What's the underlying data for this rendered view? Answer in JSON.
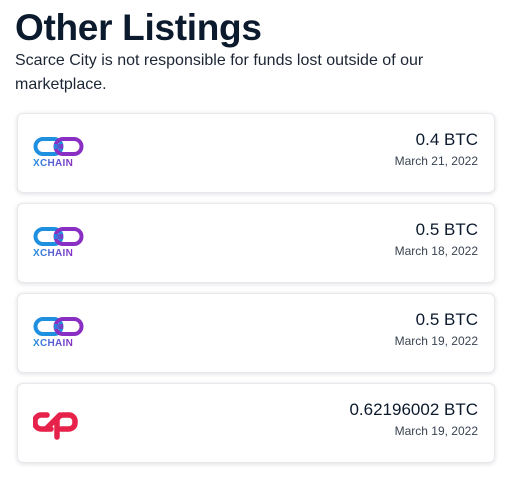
{
  "page": {
    "title": "Other Listings",
    "disclaimer": "Scarce City is not responsible for funds lost outside of our marketplace."
  },
  "listings": [
    {
      "marketplace_icon": "xchain-logo",
      "logo_text": "XCHAIN",
      "price": "0.4 BTC",
      "date": "March 21, 2022"
    },
    {
      "marketplace_icon": "xchain-logo",
      "logo_text": "XCHAIN",
      "price": "0.5 BTC",
      "date": "March 18, 2022"
    },
    {
      "marketplace_icon": "xchain-logo",
      "logo_text": "XCHAIN",
      "price": "0.5 BTC",
      "date": "March 19, 2022"
    },
    {
      "marketplace_icon": "counterparty-logo",
      "logo_text": "",
      "price": "0.62196002 BTC",
      "date": "March 19, 2022"
    }
  ],
  "colors": {
    "xchain_blue": "#1f8fe0",
    "xchain_purple": "#8a2fc4",
    "counterparty_red": "#e6224a"
  }
}
